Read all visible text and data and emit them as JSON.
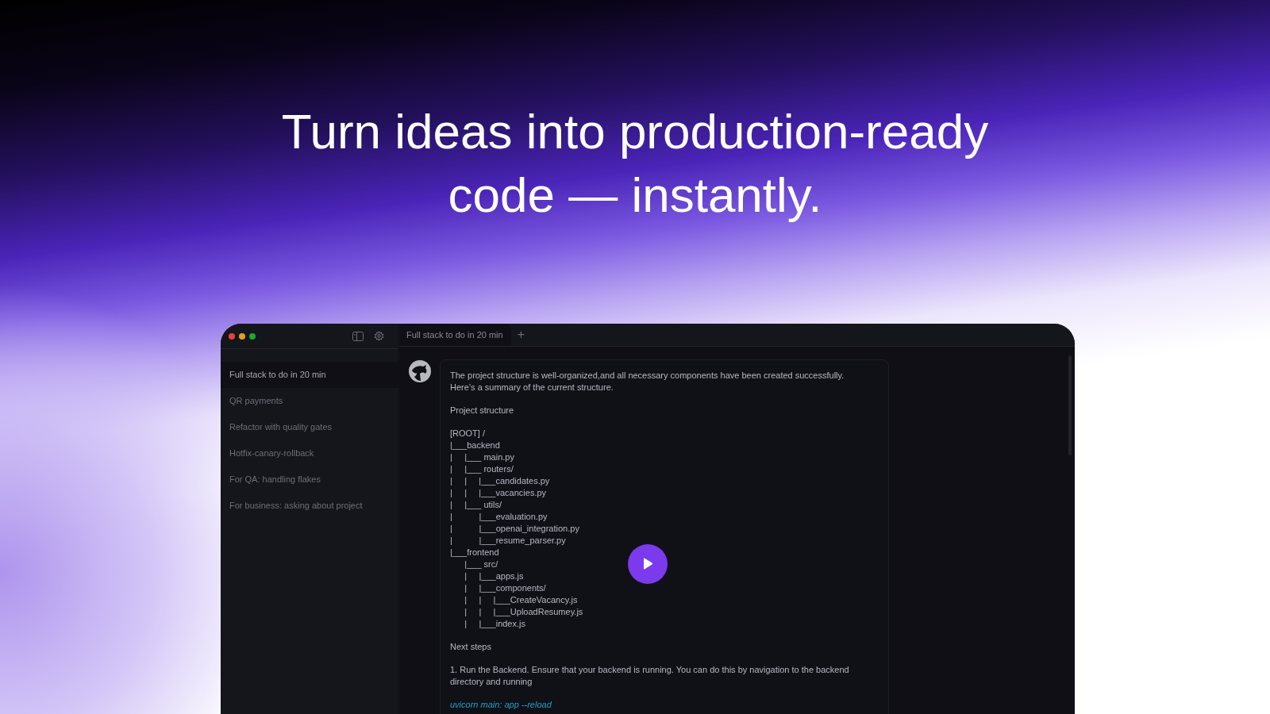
{
  "headline": "Turn ideas into production-ready code — instantly.",
  "window": {
    "traffic_lights": [
      {
        "color": "#e0443e"
      },
      {
        "color": "#dea123"
      },
      {
        "color": "#1aab29"
      }
    ]
  },
  "sidebar": {
    "items": [
      {
        "label": "Full stack to do in 20 min",
        "selected": true
      },
      {
        "label": "QR payments",
        "selected": false
      },
      {
        "label": "Refactor with quality gates",
        "selected": false
      },
      {
        "label": "Hotfix-canary-rollback",
        "selected": false
      },
      {
        "label": "For QA: handling flakes",
        "selected": false
      },
      {
        "label": "For business: asking about project",
        "selected": false
      }
    ]
  },
  "tabs": [
    {
      "label": "Full stack to do in 20 min",
      "selected": true
    }
  ],
  "new_tab": "+",
  "message": {
    "blocks": [
      {
        "kind": "text",
        "text": "The project structure is well-organized,and all necessary components have been created successfully. Here’s a summary of the current structure."
      },
      {
        "kind": "text",
        "text": "Project structure"
      },
      {
        "kind": "tree",
        "lines": [
          "[ROOT] /",
          "|___backend",
          "|     |___ main.py",
          "|     |___ routers/",
          "|     |     |___candidates.py",
          "|     |     |___vacancies.py",
          "|     |___ utils/",
          "|           |___evaluation.py",
          "|           |___openai_integration.py",
          "|           |___resume_parser.py",
          "|___frontend",
          "      |___ src/",
          "      |     |___apps.js",
          "      |     |___components/",
          "      |     |     |___CreateVacancy.js",
          "      |     |     |___UploadResumey.js",
          "      |     |___index.js"
        ]
      },
      {
        "kind": "text",
        "text": "Next steps"
      },
      {
        "kind": "text",
        "text": "1. Run the Backend. Ensure that your backend is running. You can do this by navigation to the backend directory and running"
      },
      {
        "kind": "code",
        "text": "uvicorn main: app --reload"
      }
    ]
  }
}
